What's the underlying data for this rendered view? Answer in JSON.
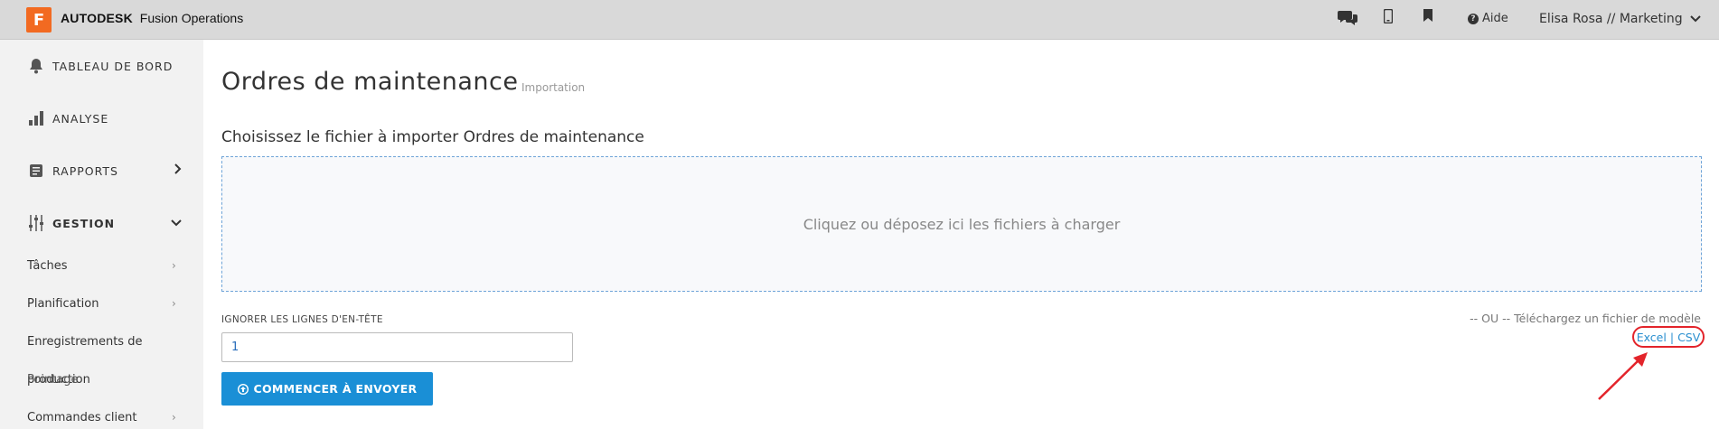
{
  "app": {
    "logo_letter": "F",
    "brand_bold": "AUTODESK",
    "brand_name": "Fusion Operations",
    "accent_color": "#f26a21"
  },
  "topbar": {
    "icons": [
      "chat-icon",
      "mobile-icon",
      "bookmark-icon"
    ],
    "help_label": "Aide",
    "user_label": "Elisa Rosa // Marketing"
  },
  "sidebar": {
    "items": [
      {
        "label": "TABLEAU DE BORD",
        "icon": "bell-icon"
      },
      {
        "label": "ANALYSE",
        "icon": "bar-chart-icon"
      },
      {
        "label": "RAPPORTS",
        "icon": "report-icon"
      },
      {
        "label": "GESTION",
        "icon": "sliders-icon"
      }
    ],
    "sub_items": [
      {
        "label": "Tâches"
      },
      {
        "label": "Planification"
      },
      {
        "label": "Enregistrements de"
      },
      {
        "label": "production"
      },
      {
        "label": "Pointage"
      },
      {
        "label": "Commandes client"
      }
    ]
  },
  "main": {
    "title": "Ordres de maintenance",
    "subtitle": "Importation",
    "section_label": "Choisissez le fichier à importer Ordres de maintenance",
    "dropzone_text": "Cliquez ou déposez ici les fichiers à charger",
    "ignore_label": "IGNORER LES LIGNES D'EN-TÊTE",
    "ignore_value": "1",
    "start_button": "COMMENCER À ENVOYER",
    "template_text": "-- OU -- Téléchargez un fichier de modèle",
    "excel_link": "Excel",
    "csv_link": "CSV",
    "link_separator": "|",
    "button_color": "#1a8fd6",
    "highlight_color": "#e3242b"
  }
}
